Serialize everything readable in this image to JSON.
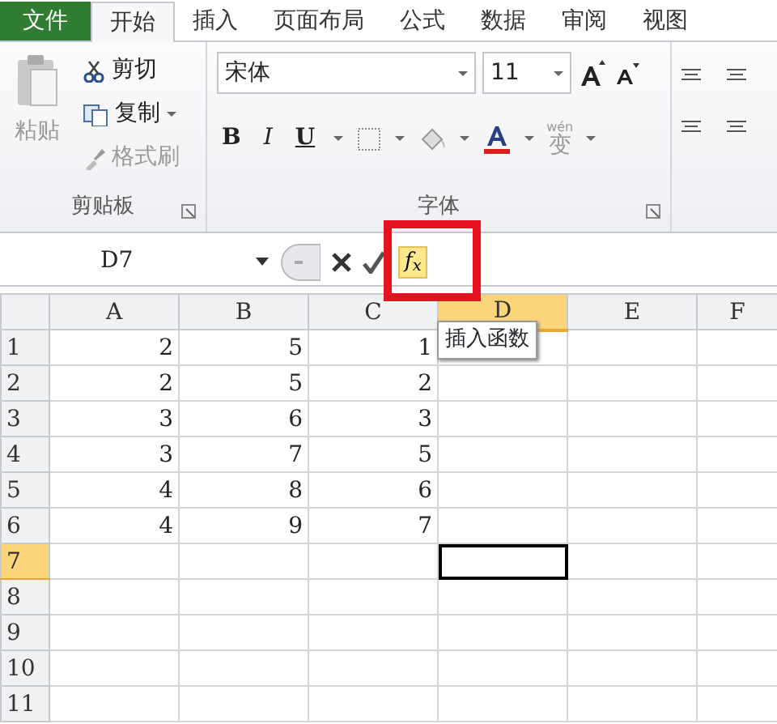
{
  "tabs": [
    {
      "label": "文件",
      "kind": "file",
      "selected": false
    },
    {
      "label": "开始",
      "kind": "tab",
      "selected": true
    },
    {
      "label": "插入",
      "kind": "tab",
      "selected": false
    },
    {
      "label": "页面布局",
      "kind": "tab",
      "selected": false
    },
    {
      "label": "公式",
      "kind": "tab",
      "selected": false
    },
    {
      "label": "数据",
      "kind": "tab",
      "selected": false
    },
    {
      "label": "审阅",
      "kind": "tab",
      "selected": false
    },
    {
      "label": "视图",
      "kind": "tab",
      "selected": false
    }
  ],
  "clipboard": {
    "paste": {
      "label": "粘贴",
      "disabled": true
    },
    "cut": {
      "label": "剪切",
      "disabled": false
    },
    "copy": {
      "label": "复制",
      "disabled": false
    },
    "format_painter": {
      "label": "格式刷",
      "disabled": true
    },
    "group_label": "剪贴板"
  },
  "font": {
    "font_name": "宋体",
    "font_size": "11",
    "bold": "B",
    "italic": "I",
    "underline": "U",
    "phonetic": {
      "ruby": "wén",
      "glyph": "变"
    },
    "group_label": "字体"
  },
  "formula_bar": {
    "name_box": "D7",
    "insert_function": "f$_{x}$",
    "tooltip": "插入函数",
    "highlighted": true
  },
  "grid": {
    "columns": [
      {
        "label": "A",
        "selected": false
      },
      {
        "label": "B",
        "selected": false
      },
      {
        "label": "C",
        "selected": false
      },
      {
        "label": "D",
        "selected": true
      },
      {
        "label": "E",
        "selected": false
      },
      {
        "label": "F",
        "selected": false
      }
    ],
    "rows": [
      {
        "label": "1",
        "selected": false,
        "cells": [
          "2",
          "5",
          "1"
        ]
      },
      {
        "label": "2",
        "selected": false,
        "cells": [
          "2",
          "5",
          "2"
        ]
      },
      {
        "label": "3",
        "selected": false,
        "cells": [
          "3",
          "6",
          "3"
        ]
      },
      {
        "label": "4",
        "selected": false,
        "cells": [
          "3",
          "7",
          "5"
        ]
      },
      {
        "label": "5",
        "selected": false,
        "cells": [
          "4",
          "8",
          "6"
        ]
      },
      {
        "label": "6",
        "selected": false,
        "cells": [
          "4",
          "9",
          "7"
        ]
      },
      {
        "label": "7",
        "selected": true,
        "cells": []
      },
      {
        "label": "8",
        "selected": false,
        "cells": []
      },
      {
        "label": "9",
        "selected": false,
        "cells": []
      },
      {
        "label": "10",
        "selected": false,
        "cells": []
      },
      {
        "label": "11",
        "selected": false,
        "cells": []
      }
    ]
  }
}
